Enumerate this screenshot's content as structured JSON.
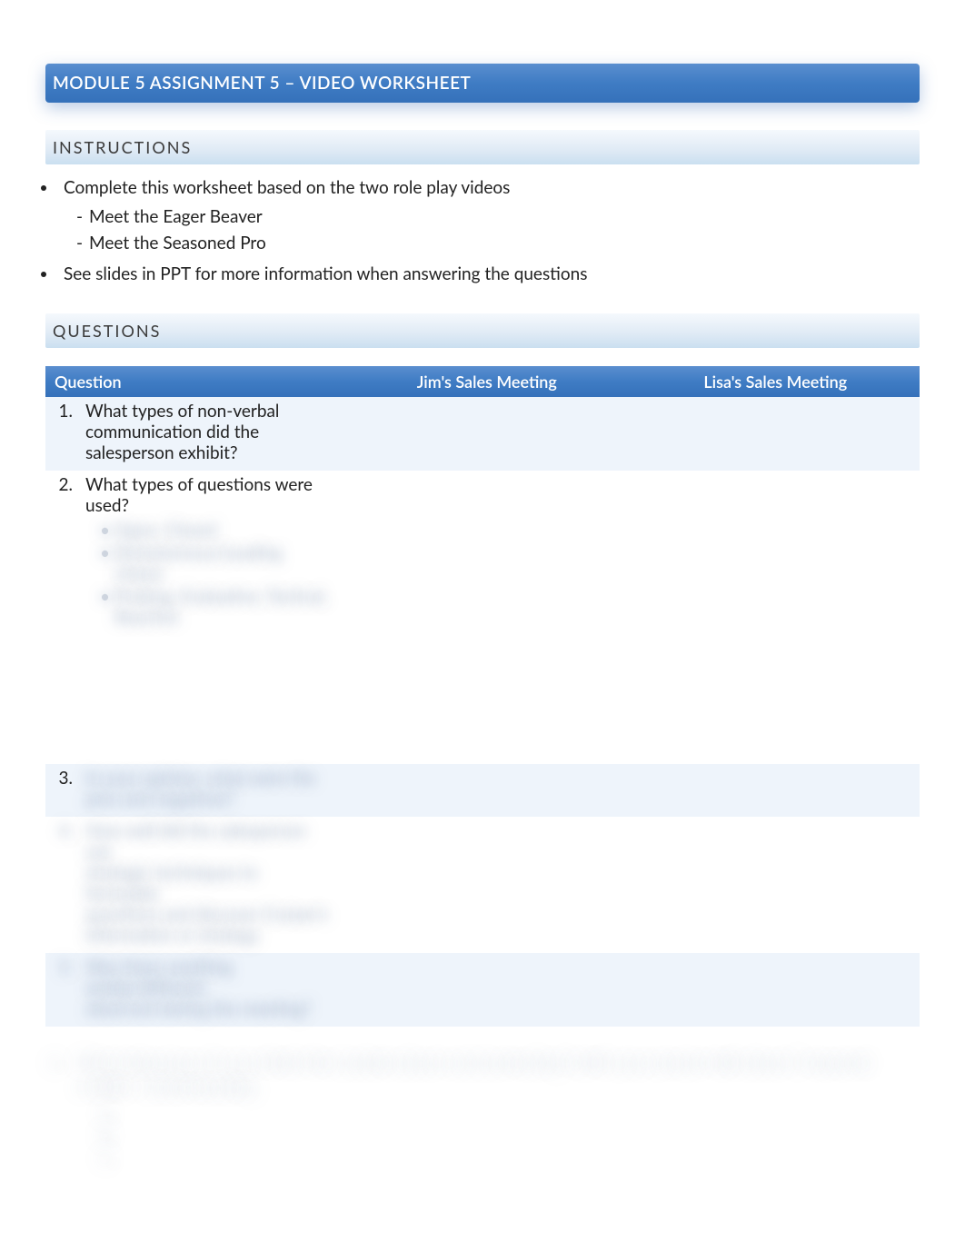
{
  "title": "MODULE 5 ASSIGNMENT 5 – VIDEO WORKSHEET",
  "sections": {
    "instructions_head": "INSTRUCTIONS",
    "questions_head": "QUESTIONS"
  },
  "instructions": {
    "item1": "Complete this worksheet based on the two role play videos",
    "sub1": "Meet the Eager Beaver",
    "sub2": "Meet the Seasoned Pro",
    "item2": "See slides in PPT for more information when answering the questions"
  },
  "table": {
    "headers": {
      "question": "Question",
      "jim": "Jim's Sales Meeting",
      "lisa": "Lisa's Sales Meeting"
    },
    "rows": [
      {
        "num": "1.",
        "text": "What types of non-verbal communication did the salesperson exhibit?",
        "jim": "",
        "lisa": ""
      },
      {
        "num": "2.",
        "text": "What types of questions were used?",
        "jim": "",
        "lisa": ""
      }
    ]
  },
  "obscured": {
    "line_a": "Open, Closed",
    "line_b": "Dichotomous/Leading choice",
    "line_c": "Probing, Evaluative, Tactical,",
    "line_d": "Reactive",
    "row3_num": "3.",
    "row3_a": "In your opinion, what were the",
    "row3_b": "pros and negatives?",
    "row4_a": "How well did the salesperson use",
    "row4_b": "strategic techniques to formulate",
    "row4_c": "questions and discover Cruiser's",
    "row4_d": "information or strategy",
    "row5_a": "Was there anything similar/different",
    "row5_b": "observed during the meeting?",
    "free_q_num": "6.",
    "free_q_text": "What takeaways do you think this module about communicating? (with your answer talk about 3 reasons)",
    "free_sub1": "Skills / Understanding",
    "b1": "A.",
    "b2": "B.",
    "b3": "C."
  }
}
